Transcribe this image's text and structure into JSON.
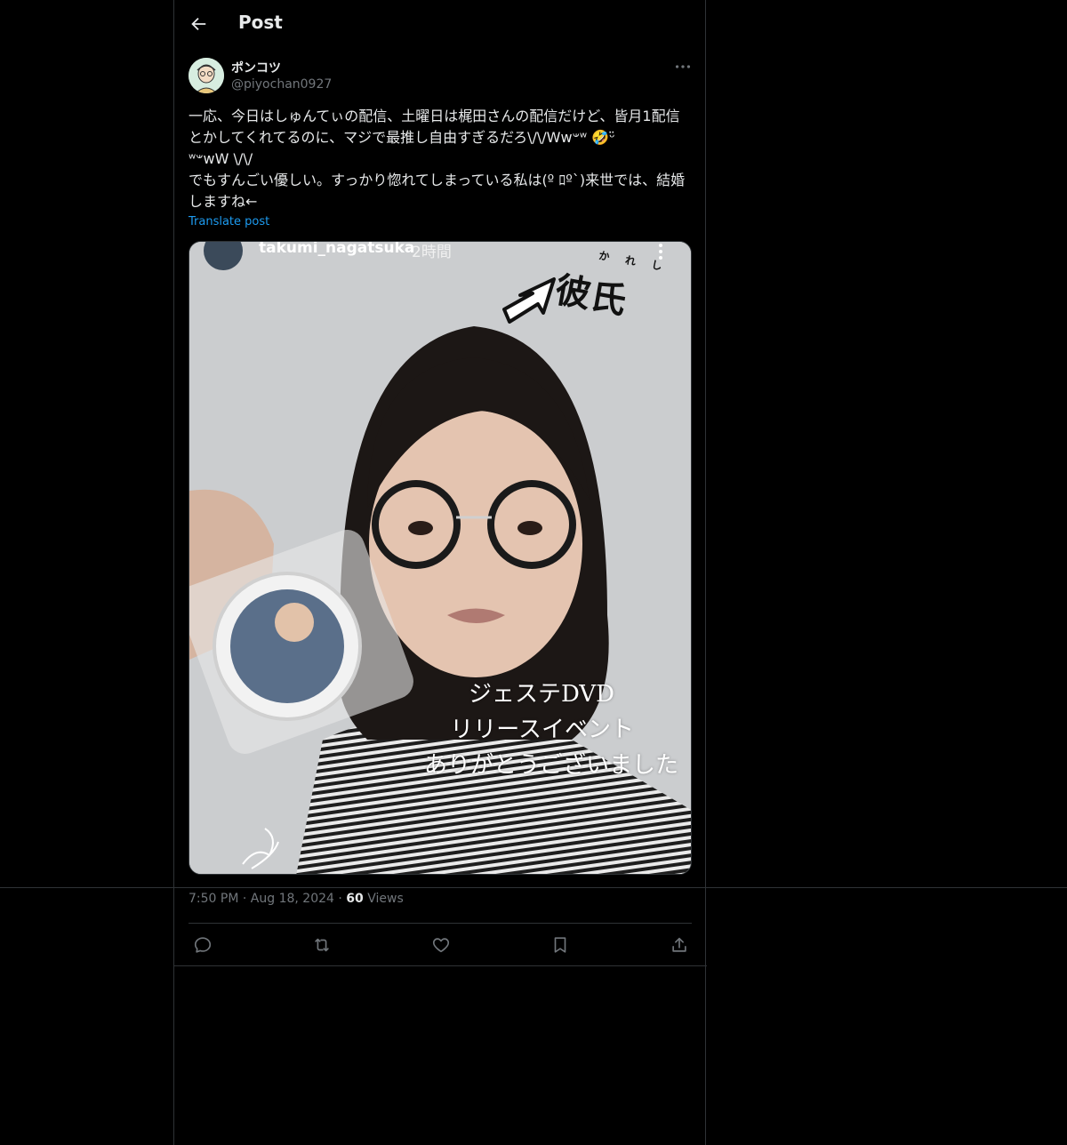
{
  "header": {
    "title": "Post"
  },
  "tweet": {
    "display_name": "ポンコツ",
    "handle": "@piyochan0927",
    "text": "一応、今日はしゅんてぃの配信、土曜日は梶田さんの配信だけど、皆月1配信とかしてくれてるのに、マジで最推し自由すぎるだろ\\/\\/Ww𐤔ʷ 🤣ᵕ̈\nʷ𐤔wW \\/\\/\nでもすんごい優しい。すっかり惚れてしまっている私は(º ﾛº`)来世では、結婚しますね←",
    "translate_label": "Translate post",
    "media": {
      "ig_username": "takumi_nagatsuka",
      "ig_time": "2時間",
      "sticker_text": "彼氏",
      "sticker_furigana": "かれし",
      "caption_lines": [
        "ジェステDVD",
        "リリースイベント",
        "ありがとうございました"
      ]
    },
    "time": "7:50 PM",
    "date": "Aug 18, 2024",
    "views_count": "60",
    "views_label": "Views",
    "dot": "·"
  },
  "icons": [
    "back-arrow-icon",
    "more-icon",
    "reply-icon",
    "retweet-icon",
    "like-icon",
    "bookmark-icon",
    "share-icon"
  ]
}
